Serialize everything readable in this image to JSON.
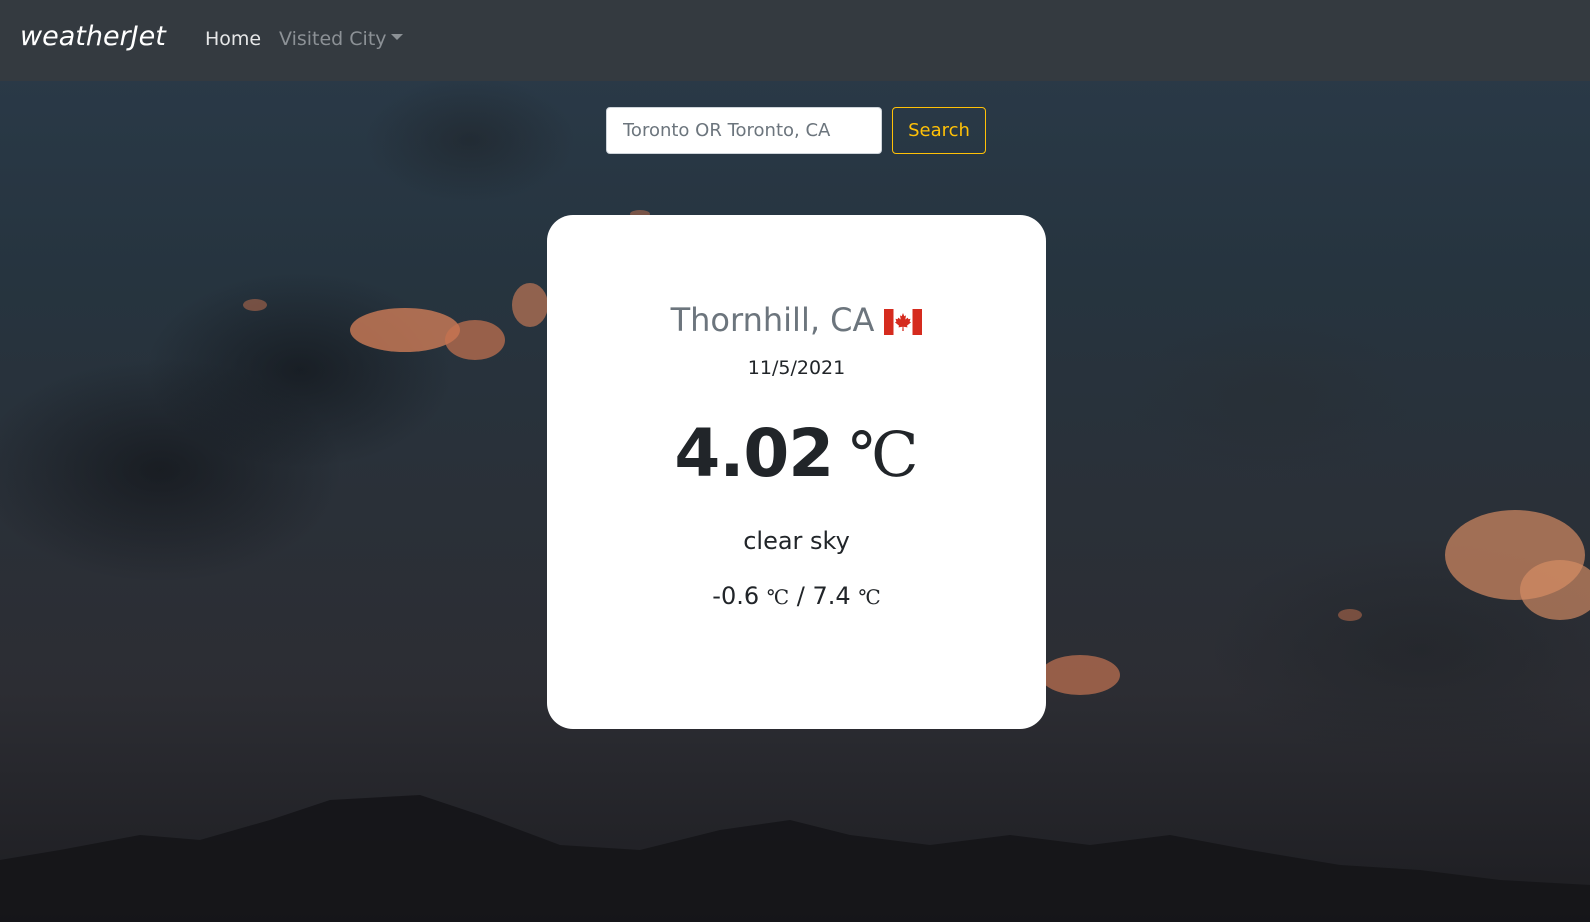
{
  "navbar": {
    "brand": "weatherJet",
    "home_label": "Home",
    "visited_label": "Visited City"
  },
  "search": {
    "placeholder": "Toronto OR Toronto, CA",
    "button_label": "Search"
  },
  "weather": {
    "city": "Thornhill, CA",
    "flag_icon": "canada-flag-icon",
    "date": "11/5/2021",
    "temperature": "4.02",
    "unit": "℃",
    "description": "clear sky",
    "min": "-0.6",
    "max": "7.4",
    "separator": "/"
  },
  "colors": {
    "navbar_bg": "#343a40",
    "accent": "#ffc107",
    "card_bg": "#ffffff",
    "city_text": "#6c757d",
    "body_text": "#212529"
  }
}
